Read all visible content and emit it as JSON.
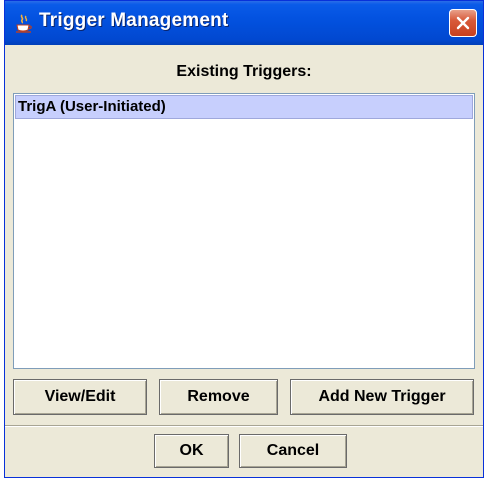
{
  "window": {
    "title": "Trigger Management",
    "icon": "java-cup-icon",
    "close_icon": "close-icon"
  },
  "header": {
    "label": "Existing Triggers:"
  },
  "triggers": {
    "items": [
      {
        "label": "TrigA (User-Initiated)",
        "selected": true
      }
    ]
  },
  "actions": {
    "view_edit": "View/Edit",
    "remove": "Remove",
    "add_new": "Add New Trigger"
  },
  "footer": {
    "ok": "OK",
    "cancel": "Cancel"
  },
  "colors": {
    "titlebar": "#0352e0",
    "window_bg": "#ece9d8",
    "selection": "#c7cffd",
    "close_button": "#d85a3a"
  }
}
